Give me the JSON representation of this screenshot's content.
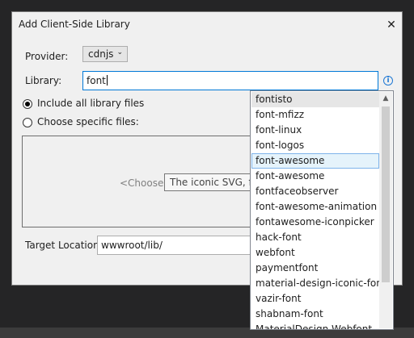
{
  "window": {
    "title": "Add Client-Side Library",
    "close_glyph": "✕"
  },
  "provider": {
    "label": "Provider:",
    "selected": "cdnjs",
    "chevron_glyph": "⌄"
  },
  "library": {
    "label": "Library:",
    "value": "font",
    "info_glyph": "i"
  },
  "options": {
    "include_all_label": "Include all library files",
    "include_all_checked": true,
    "choose_specific_label": "Choose specific files:",
    "choose_specific_checked": false
  },
  "files": {
    "placeholder": "<Choose a"
  },
  "target": {
    "label": "Target Location:",
    "value": "wwwroot/lib/"
  },
  "suggestions": {
    "items": [
      "fontisto",
      "font-mfizz",
      "font-linux",
      "font-logos",
      "font-awesome",
      "font-awesome",
      "fontfaceobserver",
      "font-awesome-animation",
      "fontawesome-iconpicker",
      "hack-font",
      "webfont",
      "paymentfont",
      "material-design-iconic-font",
      "vazir-font",
      "shabnam-font",
      "MaterialDesign-Webfont"
    ],
    "highlighted_index": 4,
    "scroll_up_glyph": "▲"
  },
  "tooltip": {
    "text": "The iconic SVG, font, and CSS toolkit"
  }
}
